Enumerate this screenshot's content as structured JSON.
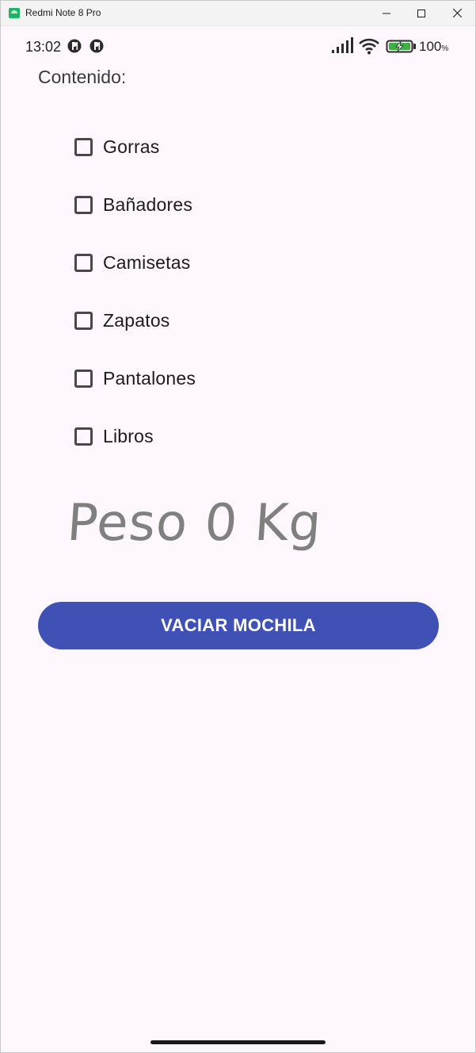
{
  "window": {
    "title": "Redmi Note 8 Pro"
  },
  "status_bar": {
    "time": "13:02",
    "battery_percent": "100",
    "battery_unit": "%"
  },
  "content": {
    "heading": "Contenido:",
    "items": [
      {
        "label": "Gorras",
        "checked": false
      },
      {
        "label": "Bañadores",
        "checked": false
      },
      {
        "label": "Camisetas",
        "checked": false
      },
      {
        "label": "Zapatos",
        "checked": false
      },
      {
        "label": "Pantalones",
        "checked": false
      },
      {
        "label": "Libros",
        "checked": false
      }
    ],
    "weight_text": "Peso 0 Kg",
    "empty_button_label": "VACIAR MOCHILA"
  },
  "colors": {
    "background": "#fef7fd",
    "button": "#3f51b5",
    "weight_text": "#808080"
  }
}
